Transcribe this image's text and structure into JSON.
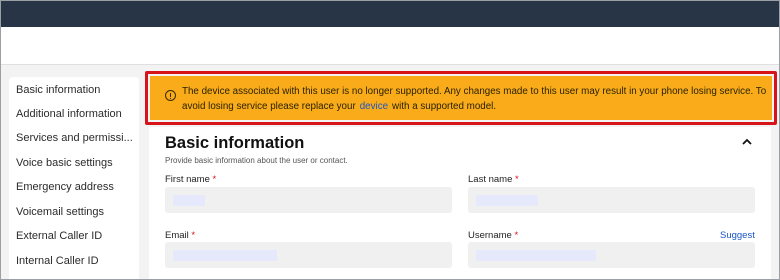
{
  "sidebar": {
    "items": [
      {
        "label": "Basic information"
      },
      {
        "label": "Additional information"
      },
      {
        "label": "Services and permissi..."
      },
      {
        "label": "Voice basic settings"
      },
      {
        "label": "Emergency address"
      },
      {
        "label": "Voicemail settings"
      },
      {
        "label": "External Caller ID"
      },
      {
        "label": "Internal Caller ID"
      }
    ]
  },
  "banner": {
    "text_before": "The device associated with this user is no longer supported. Any changes made to this user may result in your phone losing service. To avoid losing service please replace your",
    "link": "device",
    "text_after": "with a supported model.",
    "background": "#f9ab1a",
    "highlight_border": "#d7141a"
  },
  "basic_info": {
    "title": "Basic information",
    "description": "Provide basic information about the user or contact.",
    "fields": {
      "first_name": {
        "label": "First name",
        "required": "*"
      },
      "last_name": {
        "label": "Last name",
        "required": "*"
      },
      "email": {
        "label": "Email",
        "required": "*"
      },
      "username": {
        "label": "Username",
        "required": "*"
      }
    },
    "suggest_label": "Suggest"
  },
  "colors": {
    "topbar": "#283546",
    "link": "#1a56c4"
  }
}
